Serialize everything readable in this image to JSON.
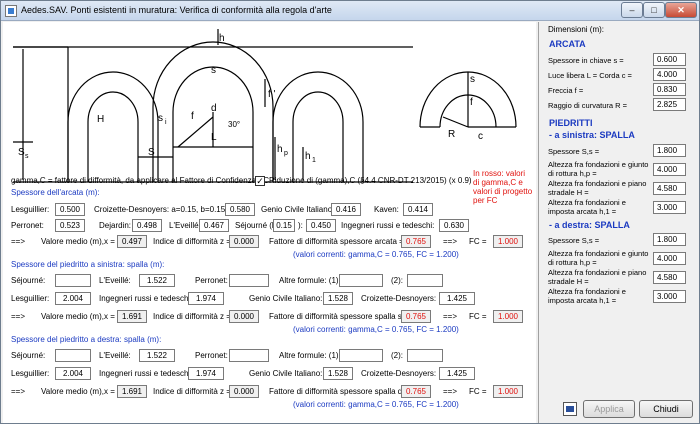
{
  "window": {
    "title": "Aedes.SAV. Ponti esistenti in muratura: Verifica di conformità alla regola d'arte"
  },
  "diagram": {
    "labels": {
      "h": "h",
      "H": "H",
      "f_prime": "f '",
      "s_top": "s",
      "s_side": "s",
      "si": "s",
      "si_sub": "i",
      "f": "f",
      "d": "d",
      "L": "L",
      "angle": "30°",
      "S": "S",
      "Ss": "S",
      "Ss_sub": "s",
      "hp": "h",
      "hp_sub": "p",
      "h1": "h",
      "h1_sub": "1",
      "r_s": "s",
      "r_f": "f",
      "r_R": "R",
      "r_c": "c"
    }
  },
  "gamma_note": "gamma,C = fattore di difformità, da applicare al Fattore di Confidenza FC",
  "reduction": {
    "checked": true,
    "label": "Riduzione di (gamma),C (§4.4 CNR-DT 213/2015) (x  0.9)"
  },
  "red_note": "In rosso: valori di gamma,C e valori di progetto per FC",
  "arcata": {
    "header": "Spessore dell'arcata (m):",
    "lesguillier_label": "Lesguillier:",
    "lesguillier": "0.500",
    "croizette_label": "Croizette-Desnoyers: a=0.15, b=0.15:",
    "croizette": "0.580",
    "genio_label": "Genio Civile Italiano:",
    "genio": "0.416",
    "kaven_label": "Kaven:",
    "kaven": "0.414",
    "perronet_label": "Perronet:",
    "perronet": "0.523",
    "dejardin_label": "Dejardin:",
    "dejardin": "0.498",
    "leveille_label": "L'Eveillé:",
    "leveille": "0.467",
    "sejourne_label": "Séjourné (k =",
    "sejourne_k": "0.15",
    "sejourne_close": "):",
    "sejourne": "0.450",
    "ingegneri_label": "Ingegneri russi e tedeschi:",
    "ingegneri": "0.630",
    "arrow": "==>",
    "media_label": "Valore medio (m),x =",
    "media": "0.497",
    "indice_label": "Indice di difformità z =",
    "indice": "0.000",
    "fattore_label": "Fattore di difformità spessore arcata =",
    "fattore": "0.765",
    "arrow2": "==>",
    "fc_label": "FC =",
    "fc": "1.000",
    "correnti": "(valori correnti: gamma,C = 0.765, FC = 1.200)"
  },
  "piedritto_sx": {
    "header": "Spessore del piedritto a sinistra: spalla (m):",
    "sejourne_label": "Séjourné:",
    "sejourne": "",
    "leveille_label": "L'Eveillé:",
    "leveille": "1.522",
    "perronet_label": "Perronet:",
    "perronet": "",
    "altre1_label": "Altre formule: (1):",
    "altre1": "",
    "altre2_label": "(2):",
    "altre2": "",
    "lesguillier_label": "Lesguillier:",
    "lesguillier": "2.004",
    "ingegneri_label": "Ingegneri russi e tedeschi:",
    "ingegneri": "1.974",
    "genio_label": "Genio Civile Italiano:",
    "genio": "1.528",
    "croizette_label": "Croizette-Desnoyers:",
    "croizette": "1.425",
    "arrow": "==>",
    "media_label": "Valore medio (m),x =",
    "media": "1.691",
    "indice_label": "Indice di difformità z =",
    "indice": "0.000",
    "fattore_label": "Fattore di difformità spessore spalla sx =",
    "fattore": "0.765",
    "arrow2": "==>",
    "fc_label": "FC =",
    "fc": "1.000",
    "correnti": "(valori correnti: gamma,C = 0.765, FC = 1.200)"
  },
  "piedritto_dx": {
    "header": "Spessore del piedritto a destra: spalla (m):",
    "sejourne_label": "Séjourné:",
    "sejourne": "",
    "leveille_label": "L'Eveillé:",
    "leveille": "1.522",
    "perronet_label": "Perronet:",
    "perronet": "",
    "altre1_label": "Altre formule: (1):",
    "altre1": "",
    "altre2_label": "(2):",
    "altre2": "",
    "lesguillier_label": "Lesguillier:",
    "lesguillier": "2.004",
    "ingegneri_label": "Ingegneri russi e tedeschi:",
    "ingegneri": "1.974",
    "genio_label": "Genio Civile Italiano:",
    "genio": "1.528",
    "croizette_label": "Croizette-Desnoyers:",
    "croizette": "1.425",
    "arrow": "==>",
    "media_label": "Valore medio (m),x =",
    "media": "1.691",
    "indice_label": "Indice di difformità z =",
    "indice": "0.000",
    "fattore_label": "Fattore di difformità spessore spalla dx =",
    "fattore": "0.765",
    "arrow2": "==>",
    "fc_label": "FC =",
    "fc": "1.000",
    "correnti": "(valori correnti: gamma,C = 0.765, FC = 1.200)"
  },
  "right": {
    "dimensioni": "Dimensioni (m):",
    "arcata_title": "ARCATA",
    "spessore_chiave_label": "Spessore in chiave s =",
    "spessore_chiave": "0.600",
    "luce_label": "Luce libera L = Corda c =",
    "luce": "4.000",
    "freccia_label": "Freccia f =",
    "freccia": "0.830",
    "raggio_label": "Raggio di curvatura R =",
    "raggio": "2.825",
    "piedritti_title": "PIEDRITTI",
    "sinistra_title": "- a sinistra: SPALLA",
    "sx_spessore_label": "Spessore S,s =",
    "sx_spessore": "1.800",
    "sx_altezza_giunto_label": "Altezza fra fondazioni e giunto di rottura h,p =",
    "sx_altezza_giunto": "4.000",
    "sx_altezza_piano_label": "Altezza fra fondazioni e piano stradale H =",
    "sx_altezza_piano": "4.580",
    "sx_altezza_imposta_label": "Altezza fra fondazioni e imposta arcata h,1 =",
    "sx_altezza_imposta": "3.000",
    "destra_title": "- a destra: SPALLA",
    "dx_spessore_label": "Spessore S,s =",
    "dx_spessore": "1.800",
    "dx_altezza_giunto_label": "Altezza fra fondazioni e giunto di rottura h,p =",
    "dx_altezza_giunto": "4.000",
    "dx_altezza_piano_label": "Altezza fra fondazioni e piano stradale H =",
    "dx_altezza_piano": "4.580",
    "dx_altezza_imposta_label": "Altezza fra fondazioni e imposta arcata h,1 =",
    "dx_altezza_imposta": "3.000"
  },
  "buttons": {
    "applica": "Applica",
    "chiudi": "Chiudi"
  }
}
